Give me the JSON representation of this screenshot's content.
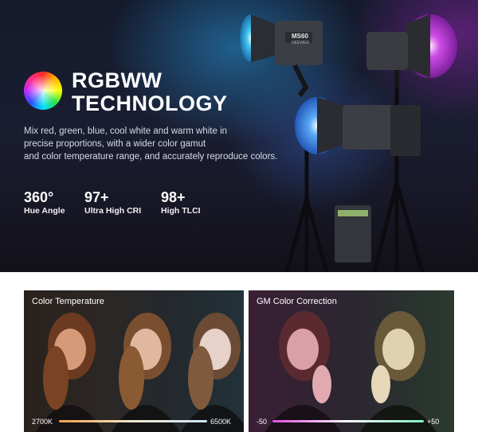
{
  "hero": {
    "title_line1": "RGBWW",
    "title_line2": "TECHNOLOGY",
    "description_lines": [
      "Mix red, green, blue, cool white and warm white in",
      "precise proportions, with a wider color gamut",
      "and color temperature range, and accurately reproduce colors."
    ],
    "stats": [
      {
        "value": "360°",
        "label": "Hue Angle"
      },
      {
        "value": "97+",
        "label": "Ultra High CRI"
      },
      {
        "value": "98+",
        "label": "High TLCI"
      }
    ],
    "light_model_label": "MS60",
    "light_brand_label": "NEEWER",
    "colors": {
      "cyan": "#27b8e8",
      "magenta": "#c43fe0",
      "blue": "#3d7ff0"
    }
  },
  "color_temperature": {
    "title": "Color Temperature",
    "min_label": "2700K",
    "max_label": "6500K",
    "bar_colors": [
      "#f0a04a",
      "#f3e9d2",
      "#cfe6f5"
    ]
  },
  "gm_correction": {
    "title": "GM Color Correction",
    "min_label": "-50",
    "max_label": "+50",
    "bar_colors": [
      "#e04ae0",
      "#ffffff",
      "#7ff0c8"
    ]
  }
}
